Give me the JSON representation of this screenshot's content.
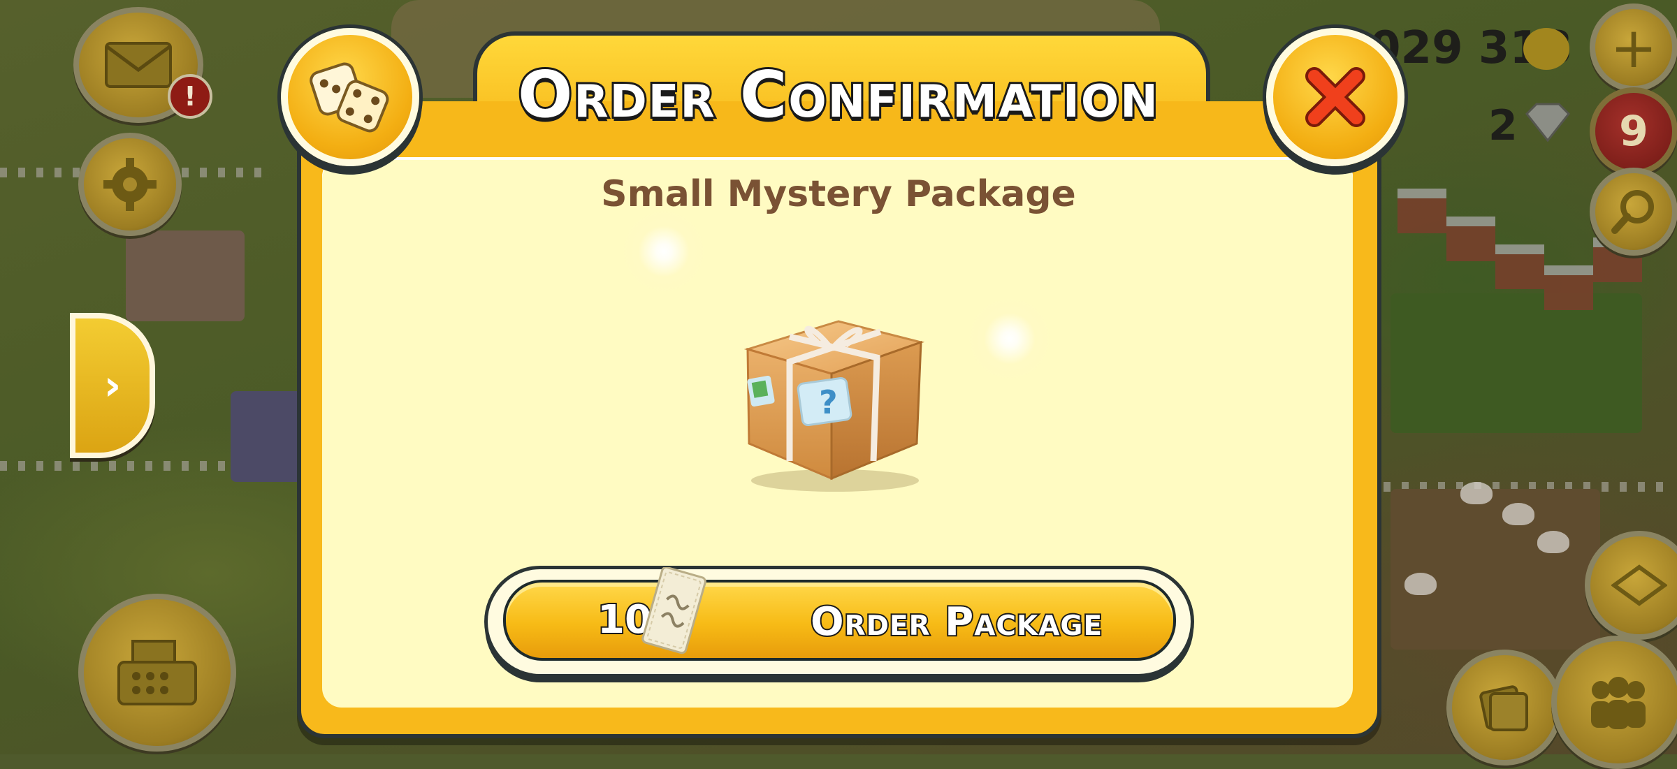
{
  "dialog": {
    "title": "Order Confirmation",
    "subtitle": "Small Mystery Package",
    "order_button": {
      "cost": "10",
      "currency_icon": "gift-card-icon",
      "label": "Order Package"
    },
    "dice_icon": "dice-icon",
    "close_icon": "close-icon"
  },
  "hud": {
    "coins": "029 318",
    "diamonds": "2",
    "level_badge": "9",
    "notification": "!"
  },
  "colors": {
    "dialog_frame": "#f8b91b",
    "panel": "#fffbc2",
    "subtitle": "#7a5234",
    "close_x": "#e8361a"
  }
}
